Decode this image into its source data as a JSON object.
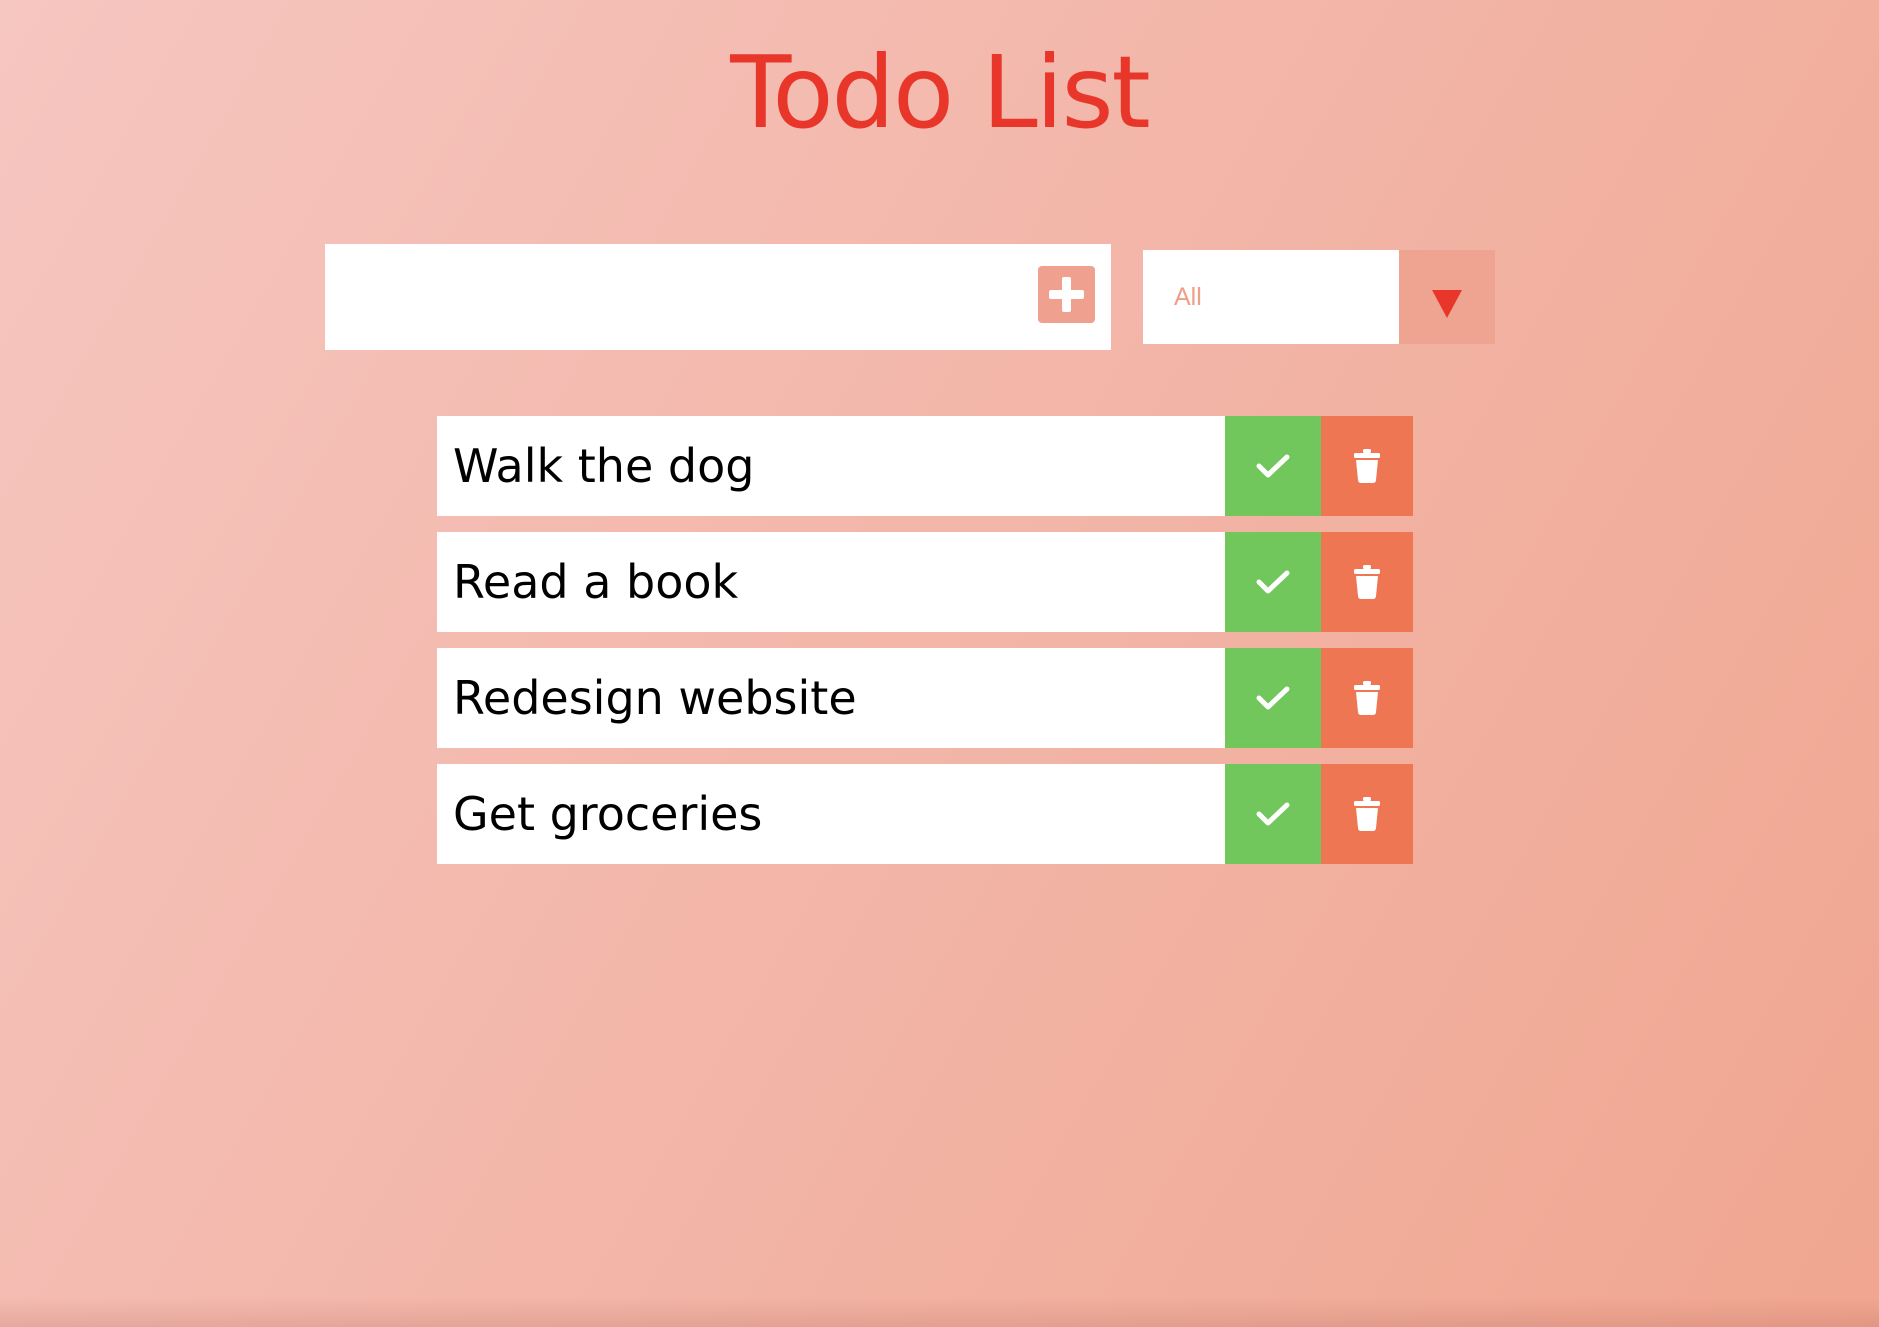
{
  "header": {
    "title": "Todo List"
  },
  "form": {
    "input_value": "",
    "input_placeholder": "",
    "add_icon": "plus-square-icon",
    "filter": {
      "selected": "All",
      "arrow_icon": "triangle-down-icon"
    }
  },
  "todos": [
    {
      "text": "Walk the dog"
    },
    {
      "text": "Read a book"
    },
    {
      "text": "Redesign website"
    },
    {
      "text": "Get groceries"
    }
  ],
  "icons": {
    "complete": "check-icon",
    "delete": "trash-icon"
  },
  "colors": {
    "title": "#e8372a",
    "accent": "#f0a08f",
    "complete": "#71c65c",
    "delete": "#ee7652",
    "filter_text": "#ee9f87"
  }
}
